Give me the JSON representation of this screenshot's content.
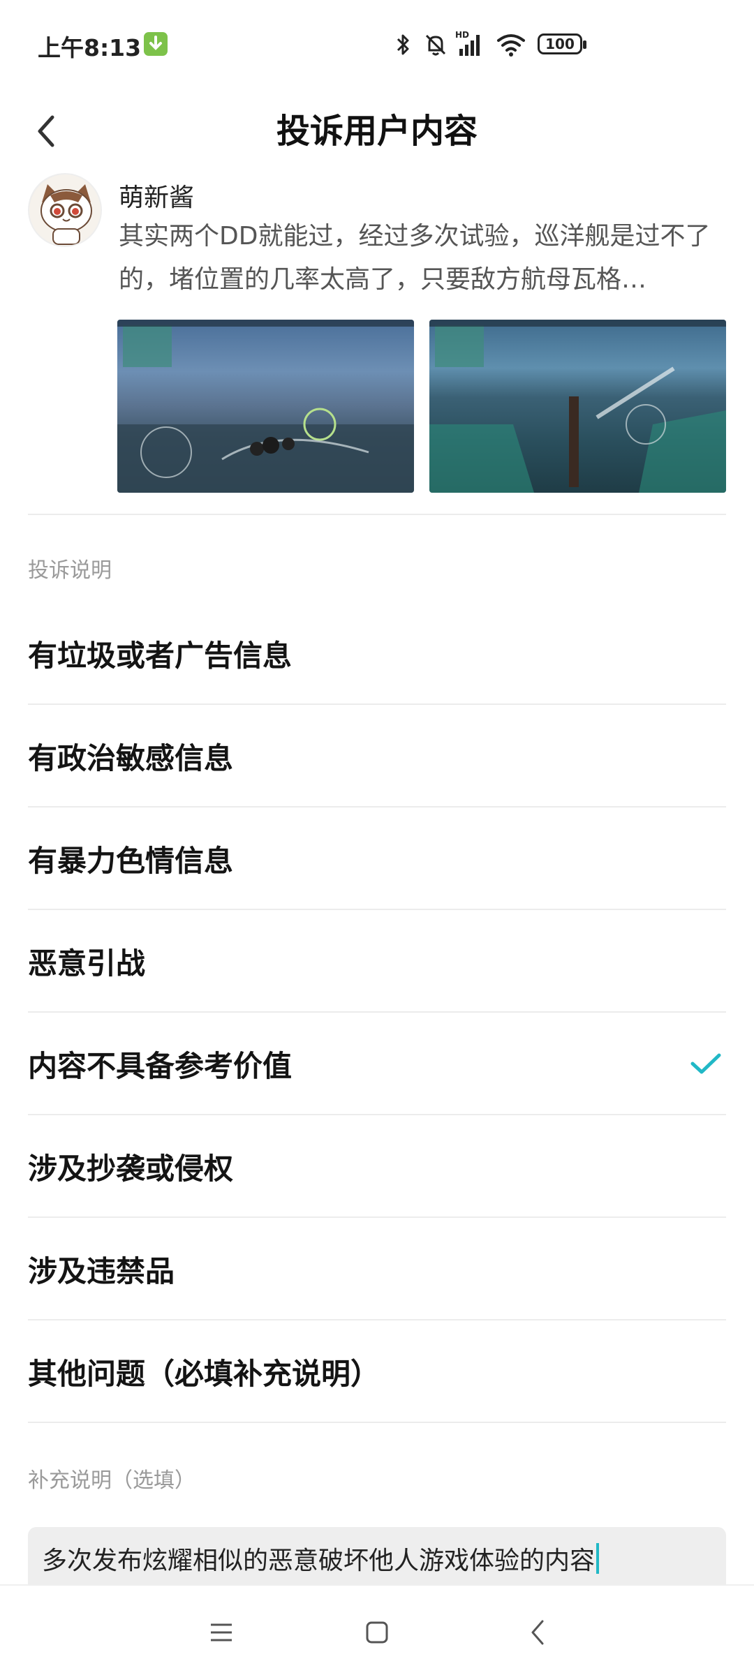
{
  "status_bar": {
    "time": "上午8:13",
    "battery": "100",
    "icons": [
      "download-badge-icon",
      "bluetooth-icon",
      "bell-off-icon",
      "hd-signal-icon",
      "wifi-icon",
      "battery-icon"
    ]
  },
  "header": {
    "title": "投诉用户内容",
    "back_icon": "chevron-left-icon"
  },
  "post": {
    "author": "萌新酱",
    "text": "其实两个DD就能过，经过多次试验，巡洋舰是过不了的，堵位置的几率太高了，只要敌方航母瓦格…",
    "images": [
      "game-screenshot-1",
      "game-screenshot-2"
    ]
  },
  "complaint": {
    "section_label": "投诉说明",
    "options": [
      {
        "label": "有垃圾或者广告信息",
        "selected": false
      },
      {
        "label": "有政治敏感信息",
        "selected": false
      },
      {
        "label": "有暴力色情信息",
        "selected": false
      },
      {
        "label": "恶意引战",
        "selected": false
      },
      {
        "label": "内容不具备参考价值",
        "selected": true
      },
      {
        "label": "涉及抄袭或侵权",
        "selected": false
      },
      {
        "label": "涉及违禁品",
        "selected": false
      },
      {
        "label": "其他问题（必填补充说明）",
        "selected": false
      }
    ]
  },
  "supplement": {
    "label": "补充说明（选填）",
    "value": "多次发布炫耀相似的恶意破坏他人游戏体验的内容"
  },
  "colors": {
    "accent": "#21b8c6",
    "divider": "#ececec",
    "muted": "#9a9a9a"
  },
  "system_nav": {
    "icons": [
      "menu-icon",
      "home-icon",
      "back-icon"
    ]
  }
}
